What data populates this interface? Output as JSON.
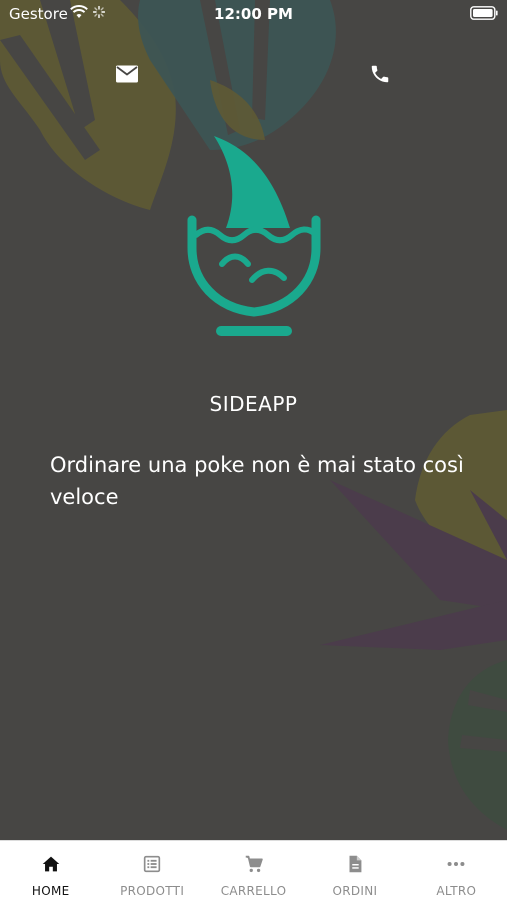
{
  "status_bar": {
    "carrier": "Gestore",
    "time": "12:00 PM"
  },
  "header": {
    "mail_icon": "mail-icon",
    "phone_icon": "phone-icon"
  },
  "brand": {
    "app_name": "SIDEAPP",
    "tagline": "Ordinare una poke non è mai stato così veloce",
    "accent_color": "#1aa98e",
    "background_color": "#474644"
  },
  "tabs": [
    {
      "label": "HOME",
      "icon": "home-icon",
      "active": true
    },
    {
      "label": "PRODOTTI",
      "icon": "list-icon",
      "active": false
    },
    {
      "label": "CARRELLO",
      "icon": "cart-icon",
      "active": false
    },
    {
      "label": "ORDINI",
      "icon": "document-icon",
      "active": false
    },
    {
      "label": "ALTRO",
      "icon": "more-icon",
      "active": false
    }
  ]
}
